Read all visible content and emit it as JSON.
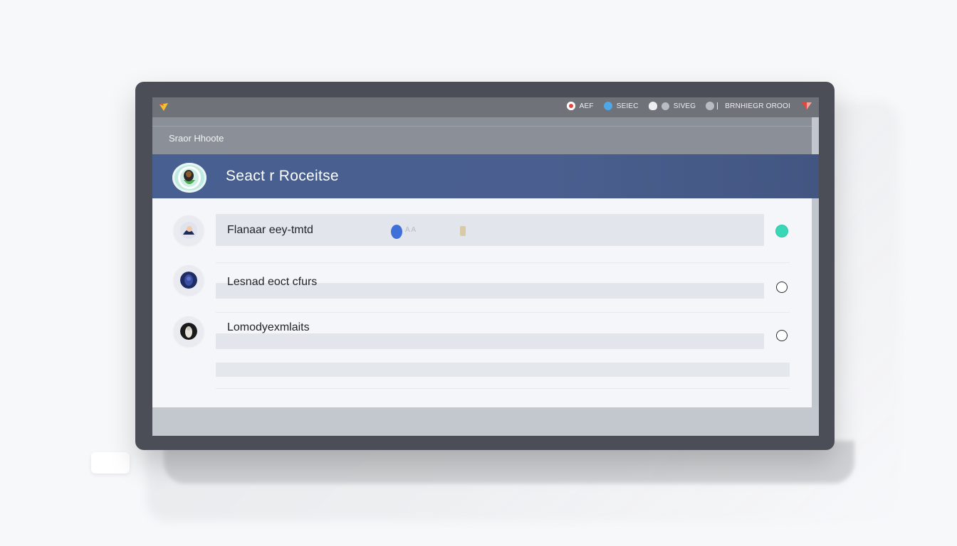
{
  "window": {
    "status_items": [
      {
        "label": "AEF",
        "dot_color": "#e8453c"
      },
      {
        "label": "SEIEC",
        "dot_color": "#4ea8e8"
      },
      {
        "label": "SIVEG",
        "dot_color": "#e8ebef"
      },
      {
        "label": "BRNHIEGR OROOI",
        "dot_color": "#b9bdc3"
      }
    ]
  },
  "search": {
    "placeholder": "Sraor Hhoote"
  },
  "header": {
    "title": "Seact r Roceitse"
  },
  "list": {
    "rows": [
      {
        "label": "Flanaar eey-tmtd",
        "status": "active",
        "inline_text": "A A"
      },
      {
        "label": "Lesnad eoct cfurs",
        "status": "inactive"
      },
      {
        "label": "Lomodyexmlaits",
        "status": "inactive"
      }
    ]
  },
  "colors": {
    "accent": "#475f91",
    "status_active": "#3ad6b8",
    "frame": "#4b4e56"
  }
}
